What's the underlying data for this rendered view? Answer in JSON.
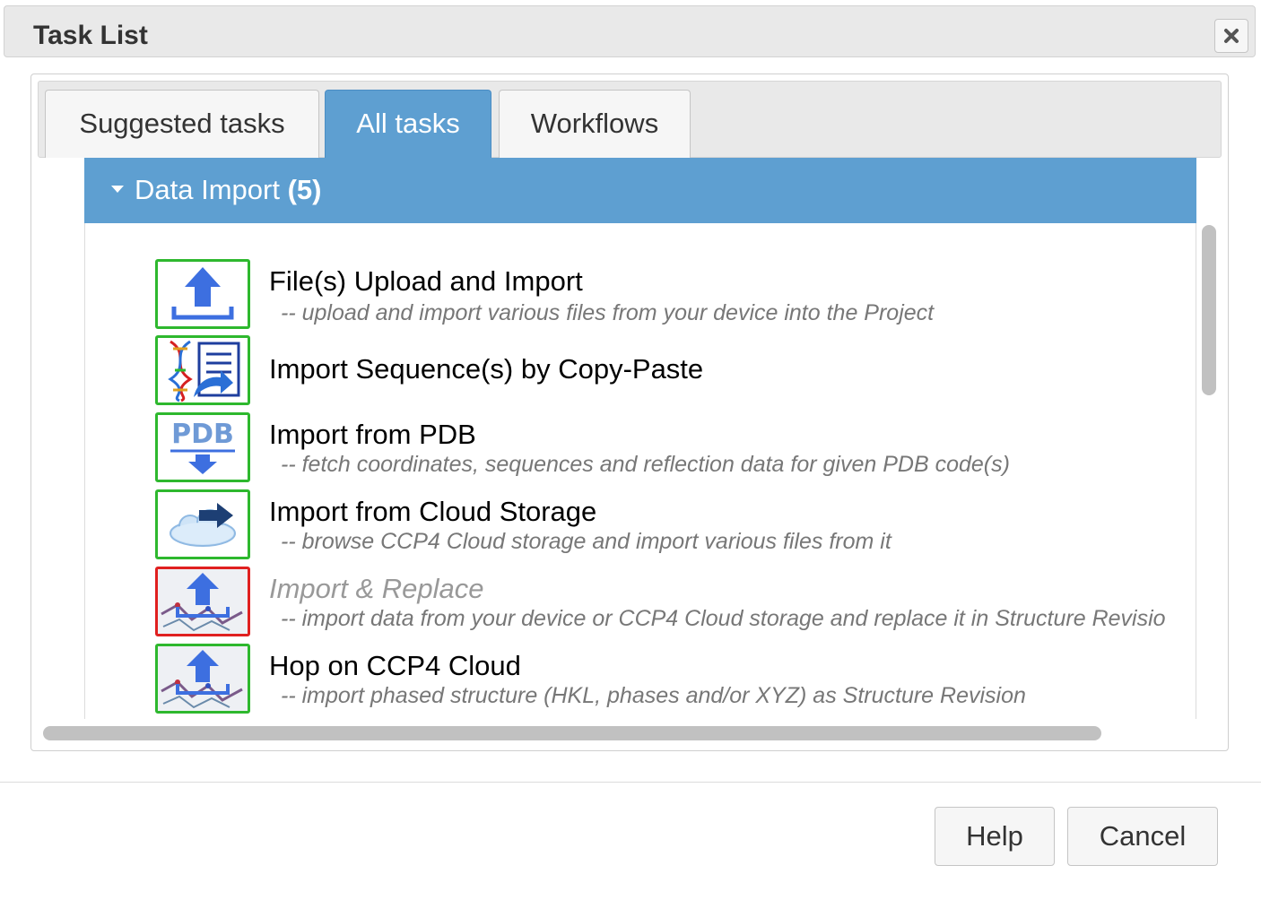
{
  "dialog": {
    "title": "Task List"
  },
  "tabs": [
    {
      "label": "Suggested tasks"
    },
    {
      "label": "All tasks",
      "active": true
    },
    {
      "label": "Workflows"
    }
  ],
  "category": {
    "name": "Data Import",
    "count": "(5)"
  },
  "tasks": [
    {
      "title": "File(s) Upload and Import",
      "description": "-- upload and import various files from your device into the Project",
      "icon": "upload-icon"
    },
    {
      "title": "Import Sequence(s) by Copy-Paste",
      "description": "",
      "icon": "sequence-paste-icon"
    },
    {
      "title": "Import from PDB",
      "description": "-- fetch coordinates, sequences and reflection data for given PDB code(s)",
      "icon": "pdb-import-icon"
    },
    {
      "title": "Import from Cloud Storage",
      "description": "-- browse CCP4 Cloud storage and import various files from it",
      "icon": "cloud-import-icon"
    },
    {
      "title": "Import & Replace",
      "description": "-- import data from your device or CCP4 Cloud storage and replace it in Structure Revisio",
      "icon": "import-replace-icon",
      "disabled": true
    },
    {
      "title": "Hop on CCP4 Cloud",
      "description": "-- import phased structure (HKL, phases and/or XYZ) as Structure Revision",
      "icon": "hop-on-cloud-icon"
    }
  ],
  "footer": {
    "help": "Help",
    "cancel": "Cancel"
  },
  "colors": {
    "accent": "#5e9fd1",
    "available_border": "#2eb82e",
    "unavailable_border": "#e02020"
  }
}
